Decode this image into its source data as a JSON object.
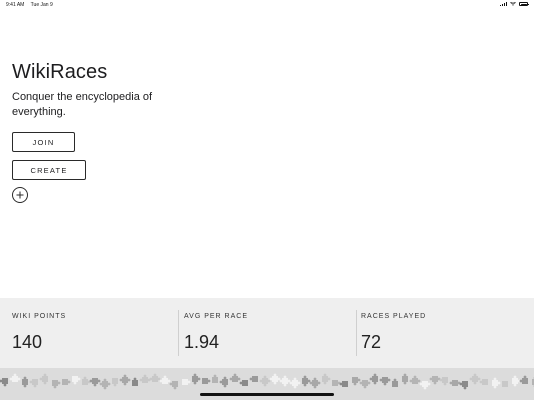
{
  "status_bar": {
    "time": "9:41 AM",
    "date": "Tue Jan 9"
  },
  "hero": {
    "title": "WikiRaces",
    "tagline": "Conquer the encyclopedia of everything."
  },
  "actions": {
    "join_label": "JOIN",
    "create_label": "CREATE",
    "add_icon": "plus-circle-icon"
  },
  "stats": [
    {
      "label": "WIKI POINTS",
      "value": "140"
    },
    {
      "label": "AVG PER RACE",
      "value": "1.94"
    },
    {
      "label": "RACES PLAYED",
      "value": "72"
    }
  ],
  "colors": {
    "background": "#ffffff",
    "stats_panel": "#efefef",
    "puzzle_strip": "#dcdcdc",
    "text": "#1d1d1f"
  }
}
